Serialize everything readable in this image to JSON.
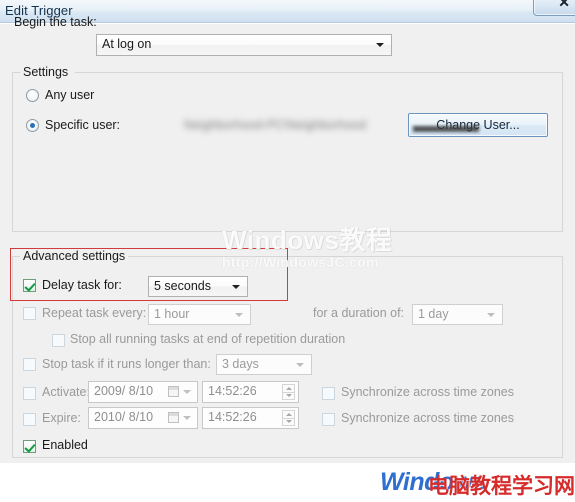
{
  "window": {
    "title": "Edit Trigger",
    "close_label": "✕"
  },
  "begin": {
    "label": "Begin the task:",
    "value": "At log on"
  },
  "settings": {
    "legend": "Settings",
    "any_user_label": "Any user",
    "specific_user_label": "Specific user:",
    "specific_user_value": "Neighborhood-PC\\Neighborhood",
    "change_user_label": "Change User..."
  },
  "advanced": {
    "legend": "Advanced settings",
    "delay_label": "Delay task for:",
    "delay_value": "5 seconds",
    "repeat_label": "Repeat task every:",
    "repeat_value": "1 hour",
    "duration_label": "for a duration of:",
    "duration_value": "1 day",
    "stop_all_label": "Stop all running tasks at end of repetition duration",
    "stop_task_label": "Stop task if it runs longer than:",
    "stop_task_value": "3 days",
    "activate_label": "Activate:",
    "activate_date": "2009/ 8/10",
    "activate_time": "14:52:26",
    "expire_label": "Expire:",
    "expire_date": "2010/ 8/10",
    "expire_time": "14:52:26",
    "sync_label_1": "Synchronize across time zones",
    "sync_label_2": "Synchronize across time zones",
    "enabled_label": "Enabled"
  },
  "watermark": {
    "center_line1": "Windows教程",
    "center_line2": "http://WindowsJC.com",
    "bottom_en": "Windows",
    "bottom_cn": "电脑教程学习网"
  },
  "colors": {
    "accent_blue": "#2b6fb5",
    "check_green": "#119944",
    "highlight_red": "#d03b3b",
    "watermark_red": "#d62b2b",
    "watermark_blue": "#2f6fd0"
  }
}
